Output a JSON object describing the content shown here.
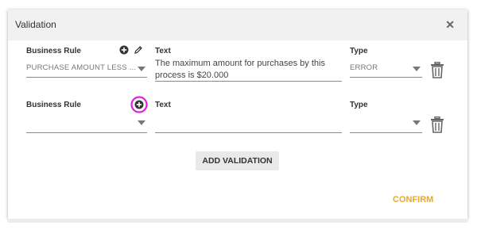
{
  "dialog": {
    "title": "Validation",
    "close_icon": "close-icon"
  },
  "rows": [
    {
      "business_rule_label": "Business Rule",
      "business_rule_value": "PURCHASE AMOUNT LESS ...",
      "text_label": "Text",
      "text_value": "The maximum amount for purchases by this process is $20.000",
      "type_label": "Type",
      "type_value": "ERROR"
    },
    {
      "business_rule_label": "Business Rule",
      "business_rule_value": "",
      "text_label": "Text",
      "text_value": "",
      "type_label": "Type",
      "type_value": ""
    }
  ],
  "actions": {
    "add_validation": "ADD VALIDATION",
    "confirm": "CONFIRM"
  },
  "colors": {
    "confirm": "#e8a92c",
    "highlight_ring": "#e020e0"
  },
  "icons": [
    "plus-circle-icon",
    "pencil-icon",
    "trash-icon",
    "chevron-down-icon",
    "close-icon"
  ]
}
